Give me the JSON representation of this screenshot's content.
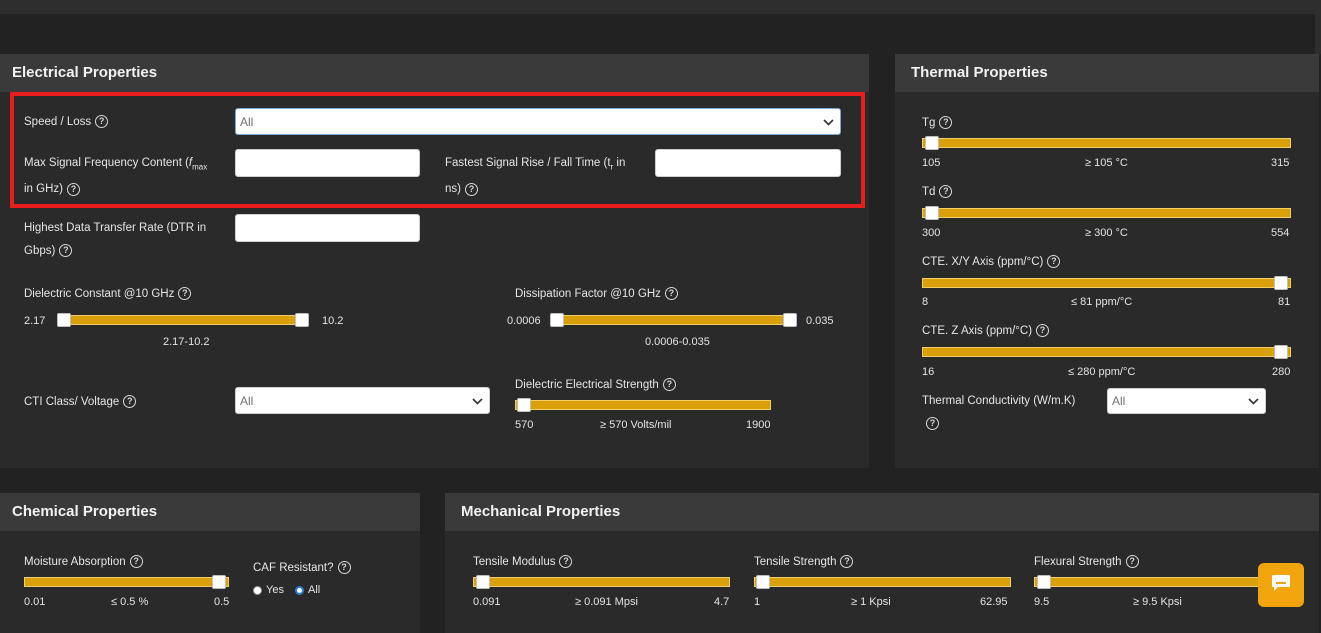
{
  "electrical": {
    "title": "Electrical Properties",
    "speed_loss": {
      "label": "Speed / Loss",
      "value": "All"
    },
    "max_freq": {
      "label_line1_a": "Max Signal Frequency Content (",
      "label_f": "f",
      "label_sub": "max",
      "label_line2": "in GHz)"
    },
    "rise_time": {
      "label_line1": "Fastest Signal Rise / Fall Time (t",
      "label_sub": "r",
      "label_line1_end": " in",
      "label_line2": "ns)"
    },
    "dtr": {
      "label_line1": "Highest Data Transfer Rate (DTR in",
      "label_line2": "Gbps)"
    },
    "dielectric_constant": {
      "label": "Dielectric Constant @10 GHz",
      "min": "2.17",
      "max": "10.2",
      "range": "2.17-10.2",
      "low_frac": 0.0,
      "high_frac": 1.0
    },
    "dissipation_factor": {
      "label": "Dissipation Factor @10 GHz",
      "min": "0.0006",
      "max": "0.035",
      "range": "0.0006-0.035",
      "low_frac": 0.0,
      "high_frac": 1.0
    },
    "cti": {
      "label": "CTI Class/ Voltage",
      "value": "All"
    },
    "des": {
      "label": "Dielectric Electrical Strength",
      "min": "570",
      "max": "1900",
      "value_text": "≥  570 Volts/mil",
      "frac": 0.0
    }
  },
  "thermal": {
    "title": "Thermal Properties",
    "tg": {
      "label": "Tg",
      "min": "105",
      "max": "315",
      "value_text": "≥ 105 °C",
      "frac": 0.0
    },
    "td": {
      "label": "Td",
      "min": "300",
      "max": "554",
      "value_text": "≥ 300 °C",
      "frac": 0.0
    },
    "cte_xy": {
      "label": "CTE. X/Y Axis (ppm/°C)",
      "min": "8",
      "max": "81",
      "value_text": "≤ 81 ppm/°C",
      "frac": 1.0
    },
    "cte_z": {
      "label": "CTE. Z Axis (ppm/°C)",
      "min": "16",
      "max": "280",
      "value_text": "≤ 280 ppm/°C",
      "frac": 1.0
    },
    "conductivity": {
      "label": "Thermal Conductivity (W/m.K)",
      "value": "All"
    }
  },
  "chemical": {
    "title": "Chemical Properties",
    "moisture": {
      "label": "Moisture Absorption",
      "min": "0.01",
      "max": "0.5",
      "value_text": "≤ 0.5 %",
      "frac": 1.0
    },
    "caf": {
      "label": "CAF Resistant?",
      "opt_yes": "Yes",
      "opt_all": "All",
      "selected": "All"
    }
  },
  "mechanical": {
    "title": "Mechanical Properties",
    "tensile_modulus": {
      "label": "Tensile Modulus",
      "min": "0.091",
      "max": "4.7",
      "value_text": "≥ 0.091 Mpsi",
      "frac": 0.0
    },
    "tensile_strength": {
      "label": "Tensile Strength",
      "min": "1",
      "max": "62.95",
      "value_text": "≥ 1 Kpsi",
      "frac": 0.0
    },
    "flexural_strength": {
      "label": "Flexural Strength",
      "min": "9.5",
      "value_text": "≥ 9.5  Kpsi",
      "frac": 0.0
    }
  },
  "colors": {
    "accent": "#d9a00c",
    "highlight": "#e81d1d",
    "chat": "#f2a40c"
  }
}
